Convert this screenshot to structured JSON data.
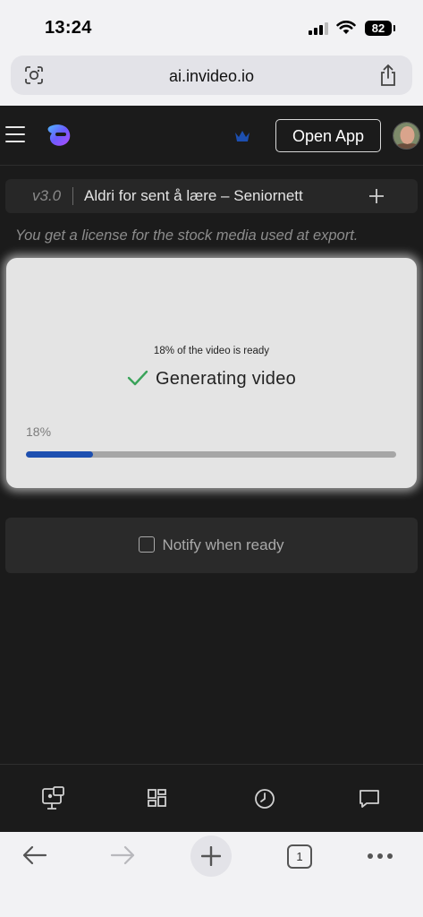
{
  "status_bar": {
    "time": "13:24",
    "battery": "82"
  },
  "browser": {
    "url": "ai.invideo.io",
    "tab_count": "1"
  },
  "header": {
    "open_app_label": "Open App"
  },
  "project": {
    "version": "v3.0",
    "title": "Aldri for sent å lære – Seniornett"
  },
  "license_note": "You get a license for the stock media used at export.",
  "generation": {
    "ready_text": "18% of the video is ready",
    "status_label": "Generating video",
    "progress_label": "18%",
    "progress_fraction": 0.18,
    "progress_color": "#1d4fb0"
  },
  "notify": {
    "label": "Notify when ready",
    "checked": false
  },
  "bottom_nav": [
    "presentation-icon",
    "grid-icon",
    "clock-icon",
    "chat-icon"
  ]
}
